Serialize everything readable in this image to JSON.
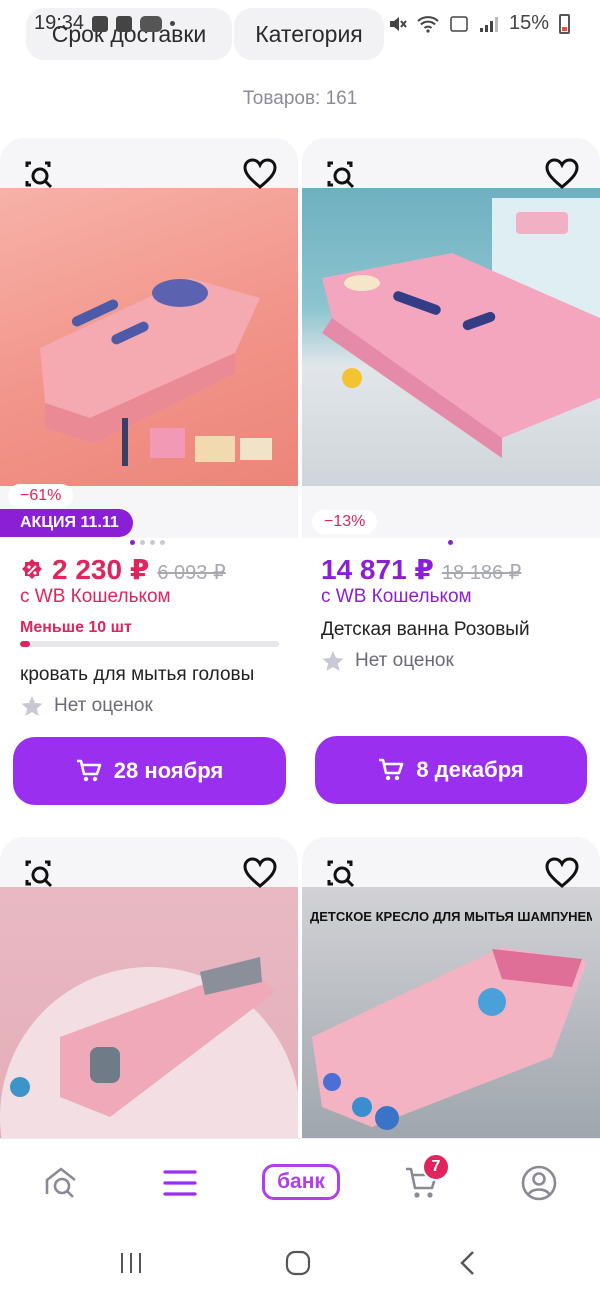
{
  "status_bar": {
    "time": "19:34",
    "battery": "15%"
  },
  "filters": {
    "delivery_label": "Срок доставки",
    "category_label": "Категория"
  },
  "results": {
    "count_text": "Товаров: 161"
  },
  "colors": {
    "accent": "#9b2ff0",
    "sale": "#e0245e",
    "price_purple": "#8b1fd6"
  },
  "products": [
    {
      "discount": "−61%",
      "promo": "АКЦИЯ 11.11",
      "price": "2 230 ₽",
      "old_price": "6 093 ₽",
      "wallet": "с WB Кошельком",
      "stock": "Меньше 10 шт",
      "stock_level": 0.04,
      "name": "кровать для мытья головы",
      "rating": "Нет оценок",
      "delivery": "28 ноября"
    },
    {
      "discount": "−13%",
      "price": "14 871 ₽",
      "old_price": "18 186 ₽",
      "wallet": "с WB Кошельком",
      "name": "Детская ванна Розовый",
      "rating": "Нет оценок",
      "delivery": "8 декабря"
    },
    {},
    {
      "image_caption": "ДЕТСКОЕ КРЕСЛО ДЛЯ МЫТЬЯ ШАМПУНЕМ"
    }
  ],
  "tabbar": {
    "icons": [
      "home-icon",
      "catalog-icon",
      "bank-icon",
      "cart-icon",
      "profile-icon"
    ],
    "bank_label": "банк",
    "cart_count": "7"
  },
  "system_nav": [
    "recent-apps-icon",
    "home-button-icon",
    "back-icon"
  ]
}
